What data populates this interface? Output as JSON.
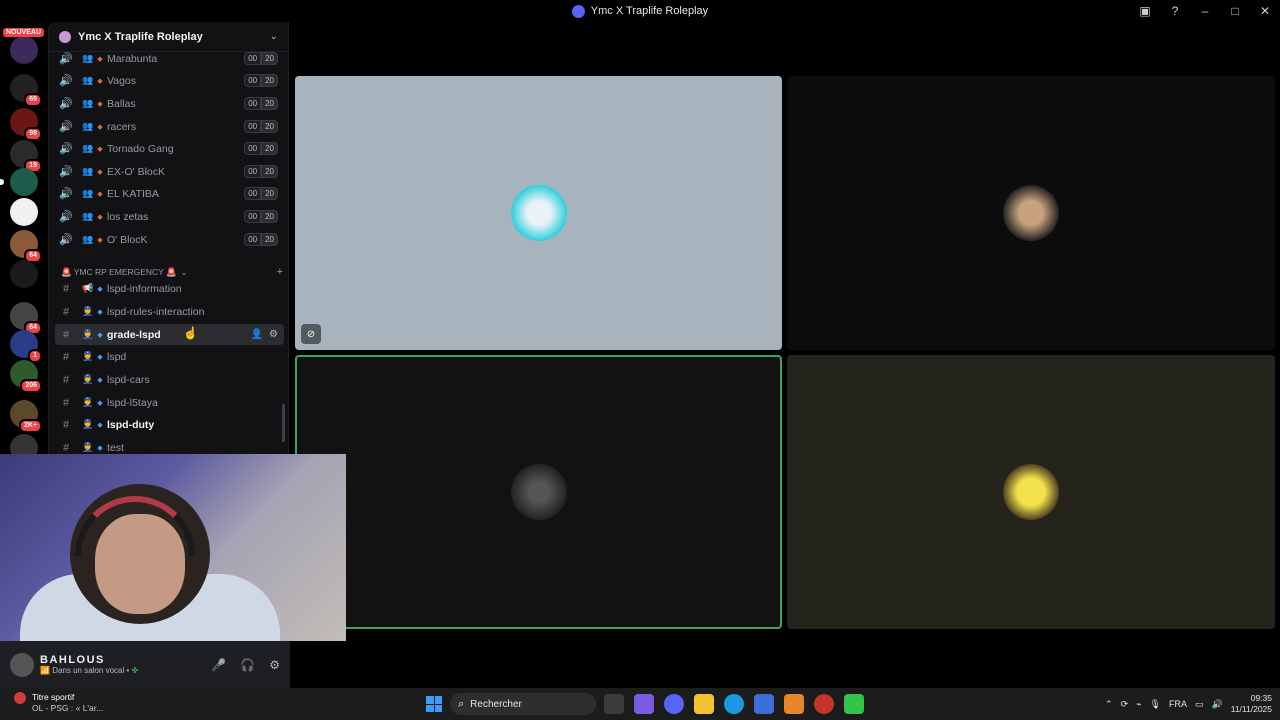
{
  "window": {
    "title": "Ymc X Traplife Roleplay"
  },
  "rail": {
    "new_badge": "NOUVEAU",
    "badges": [
      "69",
      "98",
      "19",
      "64",
      "64",
      "1",
      "206",
      "2K+"
    ]
  },
  "guild": {
    "name": "Ymc X Traplife Roleplay"
  },
  "voice_channels": [
    {
      "name": "Marabunta",
      "count": "00",
      "limit": "20"
    },
    {
      "name": "Vagos",
      "count": "00",
      "limit": "20"
    },
    {
      "name": "Ballas",
      "count": "00",
      "limit": "20"
    },
    {
      "name": "racers",
      "count": "00",
      "limit": "20"
    },
    {
      "name": "Tornado Gang",
      "count": "00",
      "limit": "20"
    },
    {
      "name": "EX-O' BlocK",
      "count": "00",
      "limit": "20"
    },
    {
      "name": "EL KATIBA",
      "count": "00",
      "limit": "20"
    },
    {
      "name": "los zetas",
      "count": "00",
      "limit": "20"
    },
    {
      "name": "O' BlocK",
      "count": "00",
      "limit": "20"
    }
  ],
  "category": {
    "name": "🚨 YMC RP EMERGENCY 🚨"
  },
  "text_channels": [
    {
      "name": "lspd-information"
    },
    {
      "name": "lspd-rules-interaction"
    },
    {
      "name": "grade-lspd"
    },
    {
      "name": "lspd"
    },
    {
      "name": "lspd-cars"
    },
    {
      "name": "lspd-l5taya"
    },
    {
      "name": "lspd-duty"
    },
    {
      "name": "test"
    }
  ],
  "user": {
    "name": "BAHLOUS",
    "status": "Dans un salon vocal •"
  },
  "taskbar": {
    "weather_title": "Titre sportif",
    "weather_sub": "OL - PSG : « L'ar...",
    "search_placeholder": "Rechercher",
    "lang": "FRA",
    "time": "09:35",
    "date": "11/11/2025"
  },
  "colors": {
    "tile1_bg": "#a7b4bd",
    "tile2_bg": "#0c0c0c",
    "tile3_bg": "#121212",
    "tile4_bg": "#25241c",
    "speaking_border": "#3ba55d",
    "mention_red": "#f23f43"
  }
}
